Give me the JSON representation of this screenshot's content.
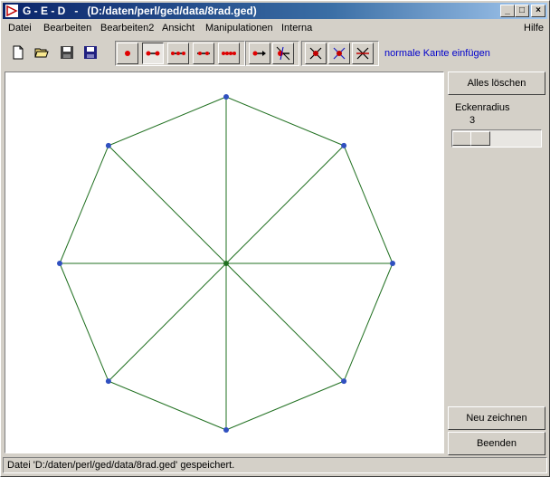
{
  "window": {
    "title": "G - E - D   -   (D:/daten/perl/ged/data/8rad.ged)",
    "controls": [
      "minimize",
      "maximize",
      "close"
    ]
  },
  "menu": {
    "items": [
      {
        "label": "Datei"
      },
      {
        "label": "Bearbeiten"
      },
      {
        "label": "Bearbeiten2"
      },
      {
        "label": "Ansicht"
      },
      {
        "label": "Manipulationen"
      },
      {
        "label": "Interna"
      }
    ],
    "help": "Hilfe"
  },
  "toolbar": {
    "file_buttons": [
      "new-file-icon",
      "open-folder-icon",
      "save-disk-icon",
      "save-as-disk-icon"
    ],
    "tool_buttons": [
      "vertex-tool",
      "edge-tool",
      "multi-edge-tool",
      "edge-vertex-tool",
      "path-tool",
      "directed-edge-tool",
      "move-vertex-tool",
      "delete-vertex-tool",
      "delete-vertex-alt-tool",
      "delete-edge-tool"
    ],
    "active_tool": "edge-tool",
    "mode_text": "normale Kante einfügen",
    "mode_color": "#0000cc"
  },
  "side": {
    "clear_label": "Alles löschen",
    "radius_label": "Eckenradius",
    "radius_value": "3",
    "redraw_label": "Neu zeichnen",
    "quit_label": "Beenden"
  },
  "graph": {
    "vertex_color": "#3050c0",
    "edge_color": "#207020",
    "center_color": "#207020",
    "vertex_count": 9,
    "edge_count": 16
  },
  "status": {
    "text": "Datei 'D:/daten/perl/ged/data/8rad.ged' gespeichert."
  }
}
